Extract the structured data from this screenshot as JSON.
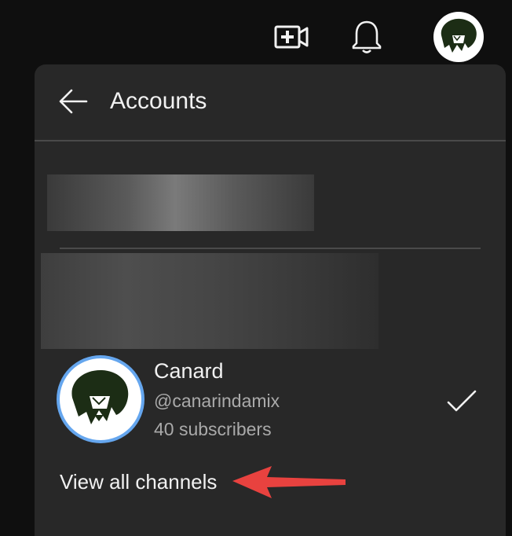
{
  "topbar": {
    "icons": [
      "create-video-icon",
      "notifications-bell-icon",
      "account-avatar"
    ]
  },
  "panel": {
    "title": "Accounts",
    "back_icon": "arrow-left-icon"
  },
  "account": {
    "name": "Canard",
    "handle": "@canarindamix",
    "subscribers": "40 subscribers",
    "selected_icon": "checkmark-icon"
  },
  "footer": {
    "view_all_label": "View all channels"
  },
  "colors": {
    "page_bg": "#0f0f0f",
    "panel_bg": "#282828",
    "text_primary": "#f1f1f1",
    "text_secondary": "#aaaaaa",
    "avatar_ring": "#65a6ee",
    "annotation_arrow": "#e8423f"
  }
}
